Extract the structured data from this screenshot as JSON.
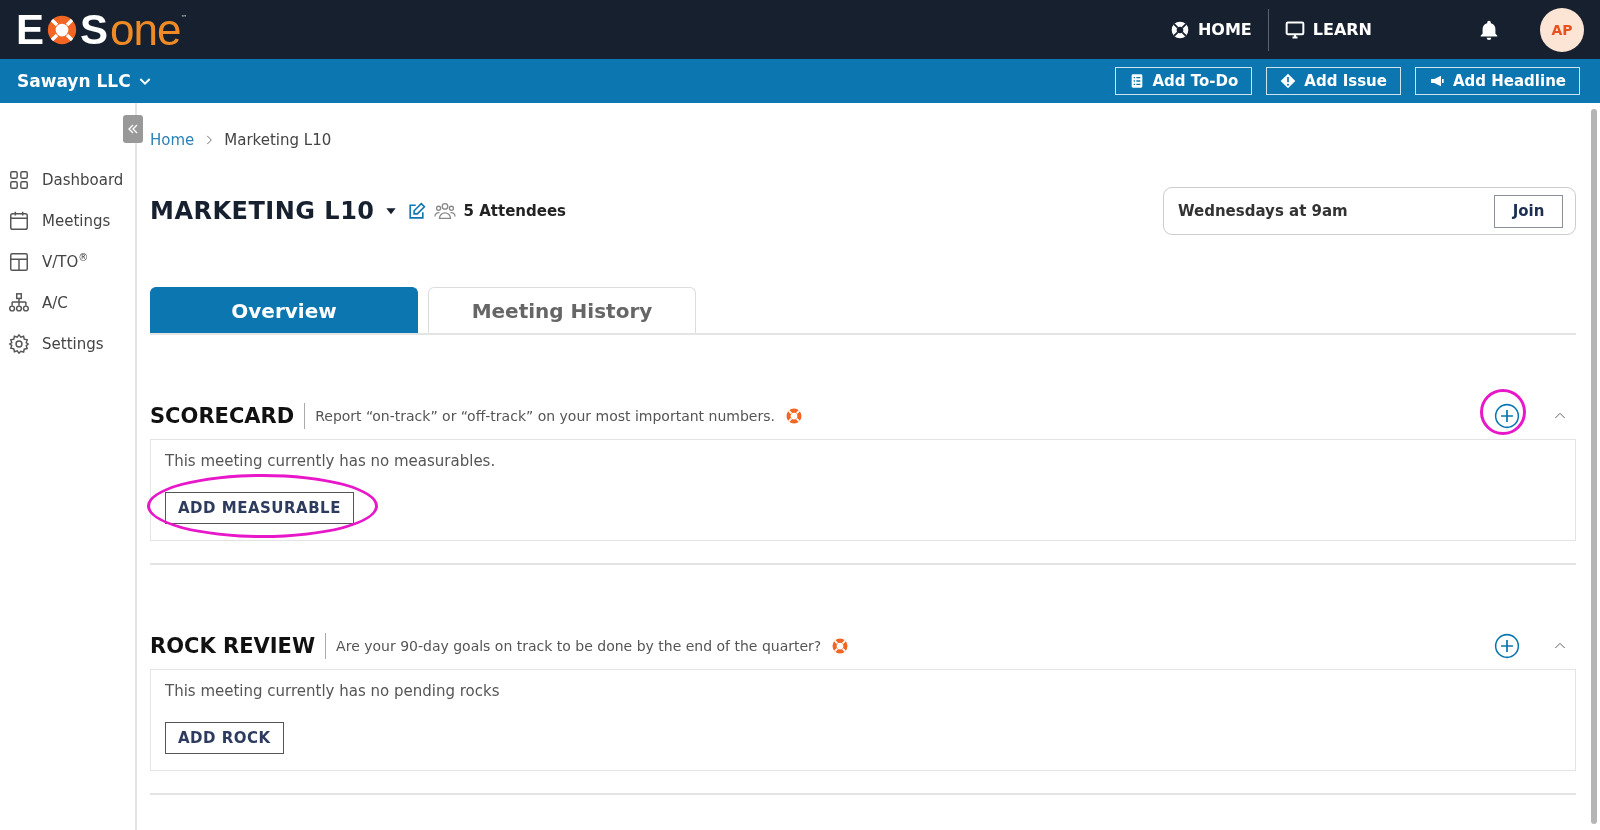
{
  "logo": {
    "first": "E",
    "second": "S",
    "suffix": "one",
    "tm": "™"
  },
  "top_nav": [
    {
      "kind": "home",
      "label": "HOME"
    },
    {
      "kind": "learn",
      "label": "LEARN"
    }
  ],
  "user": {
    "initials": "AP"
  },
  "org": {
    "name": "Sawayn LLC"
  },
  "actions": [
    {
      "kind": "todo",
      "label": "Add To-Do"
    },
    {
      "kind": "issue",
      "label": "Add Issue"
    },
    {
      "kind": "headline",
      "label": "Add Headline"
    }
  ],
  "sidebar": {
    "items": [
      {
        "kind": "dashboard",
        "label": "Dashboard"
      },
      {
        "kind": "meetings",
        "label": "Meetings"
      },
      {
        "kind": "vto",
        "label": "V/TO$^{®}$"
      },
      {
        "kind": "ac",
        "label": "A/C"
      },
      {
        "kind": "settings",
        "label": "Settings"
      }
    ]
  },
  "breadcrumb": [
    {
      "label": "Home",
      "link": true
    },
    {
      "label": "Marketing L10",
      "link": false
    }
  ],
  "meeting": {
    "title": "MARKETING L10",
    "attendees": "5 Attendees",
    "schedule": "Wednesdays at 9am",
    "join": "Join"
  },
  "tabs": [
    {
      "label": "Overview",
      "selected": true
    },
    {
      "label": "Meeting History",
      "selected": false
    }
  ],
  "sections": [
    {
      "title": "SCORECARD",
      "description": "Report “on-track” or “off-track” on your most important numbers.",
      "add_highlighted": true,
      "expanded": true,
      "empty_text": "This meeting currently has no measurables.",
      "button": {
        "label": "ADD MEASURABLE",
        "highlighted": true
      }
    },
    {
      "title": "ROCK REVIEW",
      "description": "Are your 90-day goals on track to be done by the end of the quarter?",
      "add_highlighted": false,
      "expanded": true,
      "empty_text": "This meeting currently has no pending rocks",
      "button": {
        "label": "ADD ROCK",
        "highlighted": false
      }
    }
  ]
}
